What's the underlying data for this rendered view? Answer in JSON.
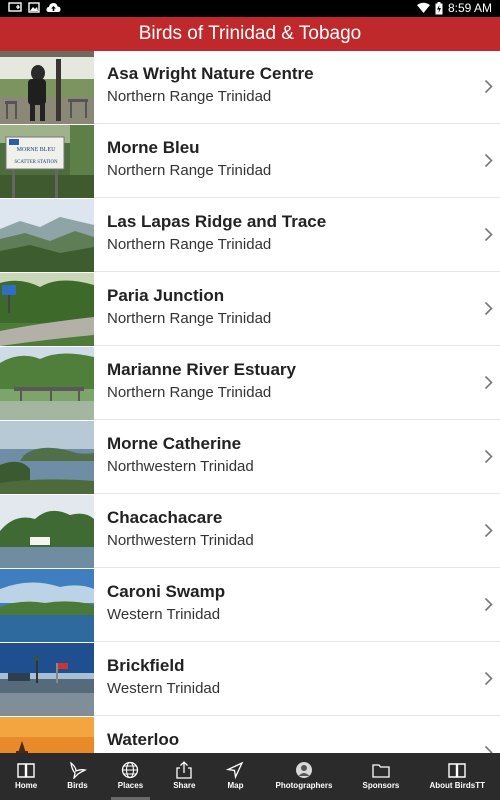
{
  "status": {
    "time": "8:59 AM"
  },
  "app": {
    "title": "Birds of Trinidad & Tobago"
  },
  "places": [
    {
      "name": "Asa Wright Nature Centre",
      "region": "Northern Range Trinidad",
      "thumb": "veranda-photo"
    },
    {
      "name": "Morne Bleu",
      "region": "Northern Range Trinidad",
      "thumb": "station-sign-photo",
      "sign_text": [
        "MORNE BLEU",
        "SCATTER STATION"
      ]
    },
    {
      "name": "Las Lapas Ridge and Trace",
      "region": "Northern Range Trinidad",
      "thumb": "forest-ridge-photo"
    },
    {
      "name": "Paria Junction",
      "region": "Northern Range Trinidad",
      "thumb": "forest-road-photo"
    },
    {
      "name": "Marianne River Estuary",
      "region": "Northern Range Trinidad",
      "thumb": "bridge-photo"
    },
    {
      "name": "Morne Catherine",
      "region": "Northwestern Trinidad",
      "thumb": "coastal-bay-photo"
    },
    {
      "name": "Chacachacare",
      "region": "Northwestern Trinidad",
      "thumb": "island-photo"
    },
    {
      "name": "Caroni Swamp",
      "region": "Western Trinidad",
      "thumb": "swamp-photo"
    },
    {
      "name": "Brickfield",
      "region": "Western Trinidad",
      "thumb": "waterfront-photo"
    },
    {
      "name": "Waterloo",
      "region": "",
      "thumb": "sunset-temple-photo"
    }
  ],
  "tabs": [
    {
      "label": "Home",
      "icon": "book-icon"
    },
    {
      "label": "Birds",
      "icon": "bird-icon"
    },
    {
      "label": "Places",
      "icon": "globe-icon",
      "active": true
    },
    {
      "label": "Share",
      "icon": "share-icon"
    },
    {
      "label": "Map",
      "icon": "navigation-arrow-icon"
    },
    {
      "label": "Photographers",
      "icon": "person-icon"
    },
    {
      "label": "Sponsors",
      "icon": "folder-icon"
    },
    {
      "label": "About BirdsTT",
      "icon": "book-icon"
    }
  ]
}
